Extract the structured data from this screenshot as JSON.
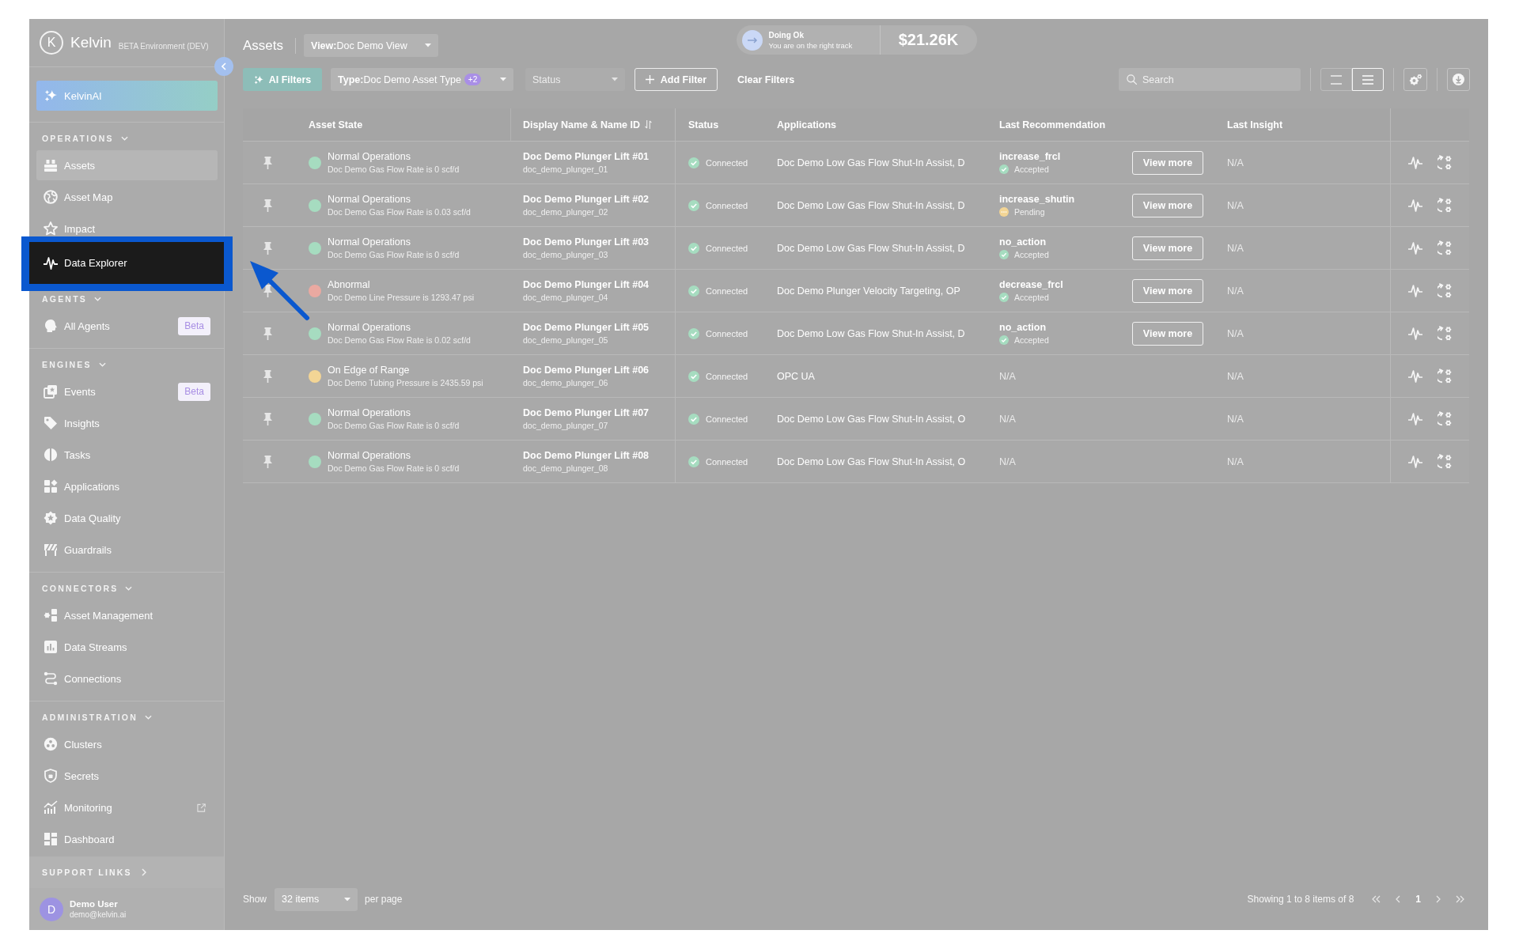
{
  "logo": {
    "mark": "K",
    "name": "Kelvin",
    "environment": "BETA Environment (DEV)"
  },
  "sidebar": {
    "assistant": {
      "label": "KelvinAI"
    },
    "sections": [
      {
        "title": "OPERATIONS",
        "expanded": true,
        "items": [
          {
            "label": "Assets",
            "selected": true,
            "highlighted": false,
            "external": false
          },
          {
            "label": "Asset Map",
            "selected": false,
            "highlighted": false,
            "external": false
          },
          {
            "label": "Impact",
            "selected": false,
            "highlighted": false,
            "external": false
          },
          {
            "label": "Data Explorer",
            "selected": false,
            "highlighted": true,
            "external": false
          }
        ]
      },
      {
        "title": "AGENTS",
        "expanded": true,
        "items": [
          {
            "label": "All Agents",
            "badge": "Beta",
            "selected": false,
            "highlighted": false,
            "external": false
          }
        ]
      },
      {
        "title": "ENGINES",
        "expanded": true,
        "items": [
          {
            "label": "Events",
            "badge": "Beta",
            "selected": false,
            "highlighted": false,
            "external": false
          },
          {
            "label": "Insights",
            "selected": false,
            "highlighted": false,
            "external": false
          },
          {
            "label": "Tasks",
            "selected": false,
            "highlighted": false,
            "external": false
          },
          {
            "label": "Applications",
            "selected": false,
            "highlighted": false,
            "external": false
          },
          {
            "label": "Data Quality",
            "selected": false,
            "highlighted": false,
            "external": false
          },
          {
            "label": "Guardrails",
            "selected": false,
            "highlighted": false,
            "external": false
          }
        ]
      },
      {
        "title": "CONNECTORS",
        "expanded": true,
        "items": [
          {
            "label": "Asset Management",
            "selected": false,
            "highlighted": false,
            "external": false
          },
          {
            "label": "Data Streams",
            "selected": false,
            "highlighted": false,
            "external": false
          },
          {
            "label": "Connections",
            "selected": false,
            "highlighted": false,
            "external": false
          }
        ]
      },
      {
        "title": "ADMINISTRATION",
        "expanded": true,
        "items": [
          {
            "label": "Clusters",
            "selected": false,
            "highlighted": false,
            "external": false
          },
          {
            "label": "Secrets",
            "selected": false,
            "highlighted": false,
            "external": false
          },
          {
            "label": "Monitoring",
            "selected": false,
            "highlighted": false,
            "external": true
          },
          {
            "label": "Dashboard",
            "selected": false,
            "highlighted": false,
            "external": false
          }
        ]
      }
    ],
    "support_links": {
      "label": "SUPPORT LINKS",
      "expanded": false
    },
    "user": {
      "initial": "D",
      "name": "Demo User",
      "email": "demo@kelvin.ai"
    }
  },
  "header": {
    "title": "Assets",
    "view": {
      "label": "**View:**Doc Demo View"
    },
    "health": {
      "title": "Doing Ok",
      "subtitle": "You are on the right track",
      "value": "$21.26K"
    }
  },
  "filters": {
    "ai": "AI Filters",
    "type": {
      "label": "**Type:**Doc Demo Asset Type",
      "badge": "+2"
    },
    "status": {
      "placeholder": "Status",
      "disabled": true
    },
    "add": "Add Filter",
    "clear": "Clear Filters",
    "search": {
      "placeholder": "Search"
    },
    "views": [
      {
        "kind": "compact",
        "selected": false
      },
      {
        "kind": "list",
        "selected": true
      }
    ]
  },
  "table": {
    "columns": [
      {
        "label": "Asset State",
        "sortable": false
      },
      {
        "label": "Display Name & Name ID",
        "sortable": true
      },
      {
        "label": "Status",
        "sortable": false
      },
      {
        "label": "Applications",
        "sortable": false
      },
      {
        "label": "Last Recommendation",
        "sortable": false
      },
      {
        "label": "Last Insight",
        "sortable": false
      }
    ],
    "rows": [
      {
        "state": {
          "label": "Normal Operations",
          "detail": "Doc Demo Gas Flow Rate is 0 scf/d",
          "color": "#a6dcc0"
        },
        "name": "Doc Demo Plunger Lift #01",
        "name_id": "doc_demo_plunger_01",
        "status": {
          "label": "Connected",
          "kind": "connected"
        },
        "applications": "Doc Demo Low Gas Flow Shut-In Assist, D",
        "recommendation": {
          "kind": "action",
          "action": "increase_frcl",
          "status": {
            "label": "Accepted",
            "kind": "accepted"
          },
          "button": "View more"
        },
        "insight": "N/A"
      },
      {
        "state": {
          "label": "Normal Operations",
          "detail": "Doc Demo Gas Flow Rate is 0.03 scf/d",
          "color": "#a6dcc0"
        },
        "name": "Doc Demo Plunger Lift #02",
        "name_id": "doc_demo_plunger_02",
        "status": {
          "label": "Connected",
          "kind": "connected"
        },
        "applications": "Doc Demo Low Gas Flow Shut-In Assist, D",
        "recommendation": {
          "kind": "action",
          "action": "increase_shutin",
          "status": {
            "label": "Pending",
            "kind": "pending"
          },
          "button": "View more"
        },
        "insight": "N/A"
      },
      {
        "state": {
          "label": "Normal Operations",
          "detail": "Doc Demo Gas Flow Rate is 0 scf/d",
          "color": "#a6dcc0"
        },
        "name": "Doc Demo Plunger Lift #03",
        "name_id": "doc_demo_plunger_03",
        "status": {
          "label": "Connected",
          "kind": "connected"
        },
        "applications": "Doc Demo Low Gas Flow Shut-In Assist, D",
        "recommendation": {
          "kind": "action",
          "action": "no_action",
          "status": {
            "label": "Accepted",
            "kind": "accepted"
          },
          "button": "View more"
        },
        "insight": "N/A"
      },
      {
        "state": {
          "label": "Abnormal",
          "detail": "Doc Demo Line Pressure is 1293.47 psi",
          "color": "#eaa9a1"
        },
        "name": "Doc Demo Plunger Lift #04",
        "name_id": "doc_demo_plunger_04",
        "status": {
          "label": "Connected",
          "kind": "connected"
        },
        "applications": "Doc Demo Plunger Velocity Targeting, OP",
        "recommendation": {
          "kind": "action",
          "action": "decrease_frcl",
          "status": {
            "label": "Accepted",
            "kind": "accepted"
          },
          "button": "View more"
        },
        "insight": "N/A"
      },
      {
        "state": {
          "label": "Normal Operations",
          "detail": "Doc Demo Gas Flow Rate is 0.02 scf/d",
          "color": "#a6dcc0"
        },
        "name": "Doc Demo Plunger Lift #05",
        "name_id": "doc_demo_plunger_05",
        "status": {
          "label": "Connected",
          "kind": "connected"
        },
        "applications": "Doc Demo Low Gas Flow Shut-In Assist, D",
        "recommendation": {
          "kind": "action",
          "action": "no_action",
          "status": {
            "label": "Accepted",
            "kind": "accepted"
          },
          "button": "View more"
        },
        "insight": "N/A"
      },
      {
        "state": {
          "label": "On Edge of Range",
          "detail": "Doc Demo Tubing Pressure is 2435.59 psi",
          "color": "#f3d595"
        },
        "name": "Doc Demo Plunger Lift #06",
        "name_id": "doc_demo_plunger_06",
        "status": {
          "label": "Connected",
          "kind": "connected"
        },
        "applications": "OPC UA",
        "recommendation": {
          "kind": "empty",
          "text": "N/A"
        },
        "insight": "N/A"
      },
      {
        "state": {
          "label": "Normal Operations",
          "detail": "Doc Demo Gas Flow Rate is 0 scf/d",
          "color": "#a6dcc0"
        },
        "name": "Doc Demo Plunger Lift #07",
        "name_id": "doc_demo_plunger_07",
        "status": {
          "label": "Connected",
          "kind": "connected"
        },
        "applications": "Doc Demo Low Gas Flow Shut-In Assist, O",
        "recommendation": {
          "kind": "empty",
          "text": "N/A"
        },
        "insight": "N/A"
      },
      {
        "state": {
          "label": "Normal Operations",
          "detail": "Doc Demo Gas Flow Rate is 0 scf/d",
          "color": "#a6dcc0"
        },
        "name": "Doc Demo Plunger Lift #08",
        "name_id": "doc_demo_plunger_08",
        "status": {
          "label": "Connected",
          "kind": "connected"
        },
        "applications": "Doc Demo Low Gas Flow Shut-In Assist, O",
        "recommendation": {
          "kind": "empty",
          "text": "N/A"
        },
        "insight": "N/A"
      }
    ]
  },
  "footer": {
    "show": "Show",
    "page_size": "32 items",
    "per_page": "per page",
    "summary": "Showing 1 to 8 items of 8",
    "pages": [
      {
        "label": "1",
        "selected": true
      }
    ]
  }
}
